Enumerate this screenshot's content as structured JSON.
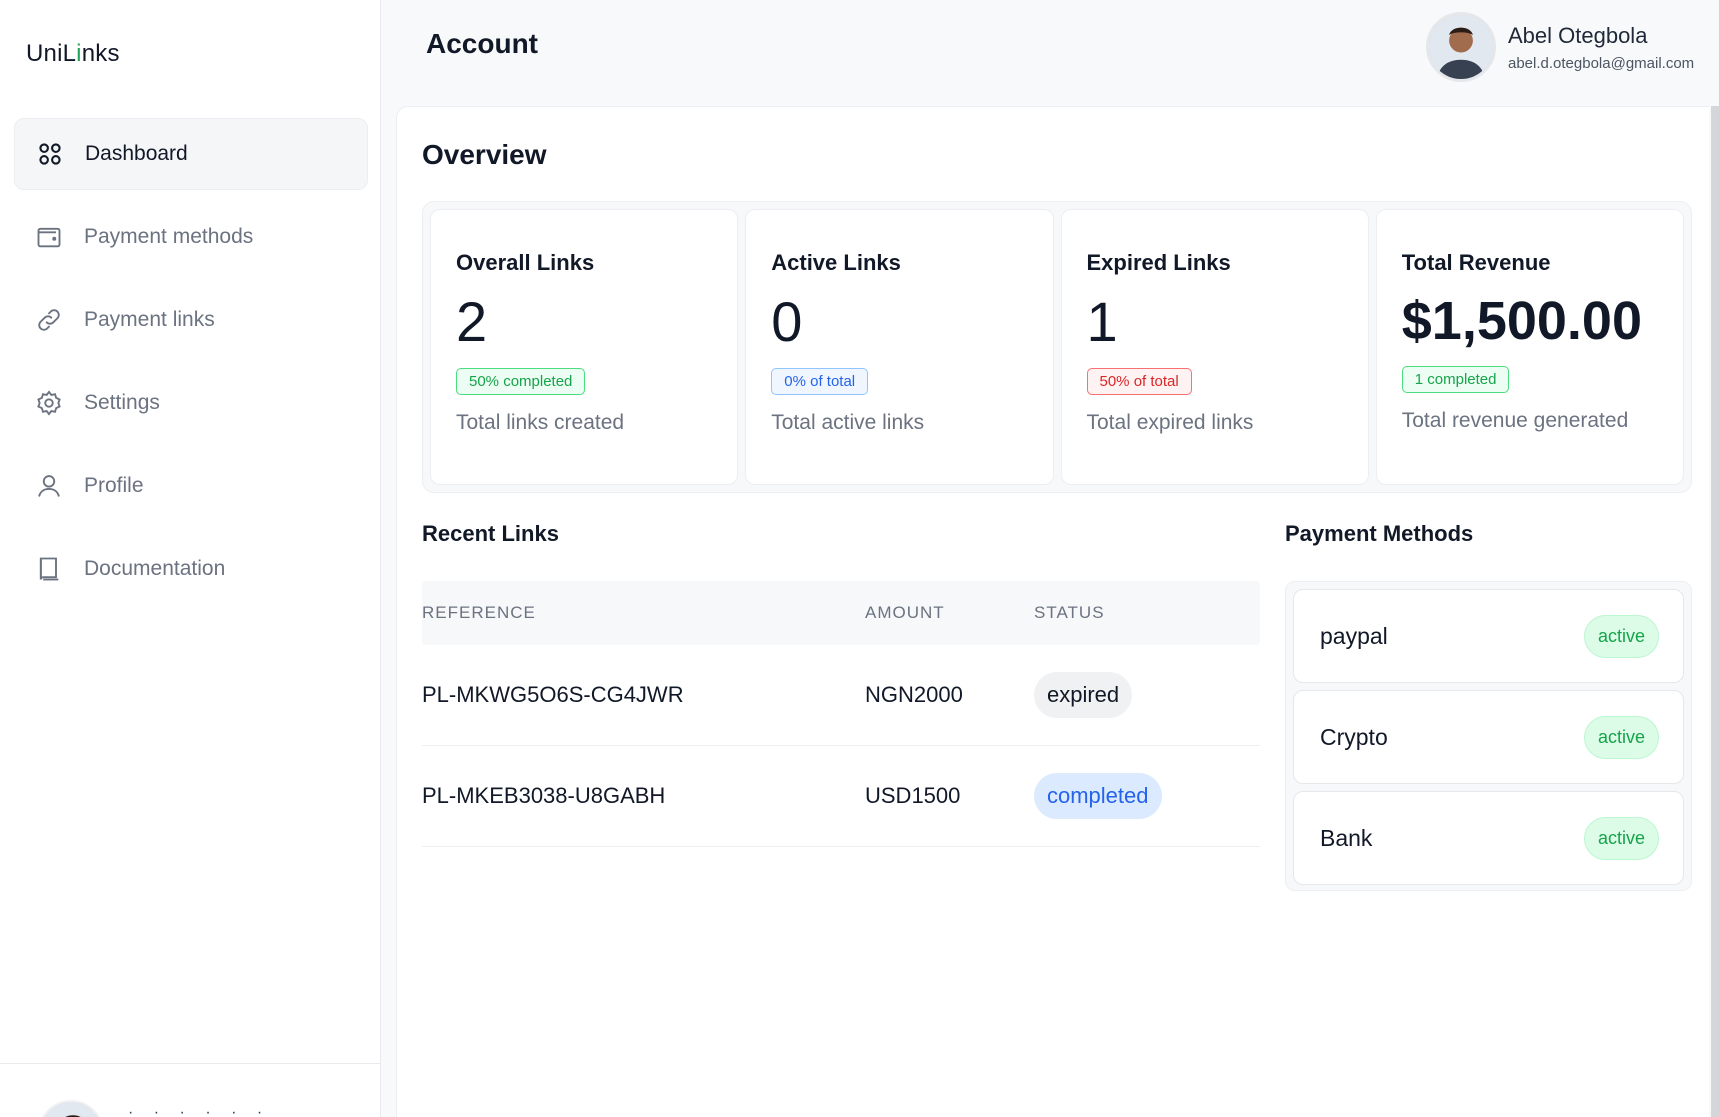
{
  "brand": {
    "name_before": "UniL",
    "name_dot": "i",
    "name_after": "nks"
  },
  "header": {
    "title": "Account"
  },
  "user": {
    "name": "Abel Otegbola",
    "email": "abel.d.otegbola@gmail.com"
  },
  "sidebar": {
    "items": [
      {
        "label": "Dashboard",
        "icon": "grid-icon",
        "active": true
      },
      {
        "label": "Payment methods",
        "icon": "wallet-icon"
      },
      {
        "label": "Payment links",
        "icon": "link-icon"
      },
      {
        "label": "Settings",
        "icon": "gear-icon"
      },
      {
        "label": "Profile",
        "icon": "user-icon"
      },
      {
        "label": "Documentation",
        "icon": "book-icon"
      }
    ],
    "footer_dots": "· · · · · ·"
  },
  "overview": {
    "title": "Overview",
    "stats": [
      {
        "title": "Overall Links",
        "value": "2",
        "pill": "50% completed",
        "pill_color": "#16a34a",
        "subtitle": "Total links created"
      },
      {
        "title": "Active Links",
        "value": "0",
        "pill": "0% of total",
        "pill_color": "#2563eb",
        "subtitle": "Total active links"
      },
      {
        "title": "Expired Links",
        "value": "1",
        "pill": "50% of total",
        "pill_color": "#dc2626",
        "subtitle": "Total expired links"
      },
      {
        "title": "Total Revenue",
        "value": "$1,500.00",
        "pill": "1 completed",
        "pill_color": "#16a34a",
        "subtitle": "Total revenue generated"
      }
    ]
  },
  "recent_links": {
    "title": "Recent Links",
    "columns": [
      "REFERENCE",
      "AMOUNT",
      "STATUS"
    ],
    "rows": [
      {
        "reference": "PL-MKWG5O6S-CG4JWR",
        "amount": "NGN2000",
        "status": "expired"
      },
      {
        "reference": "PL-MKEB3038-U8GABH",
        "amount": "USD1500",
        "status": "completed"
      }
    ]
  },
  "payment_methods": {
    "title": "Payment Methods",
    "items": [
      {
        "name": "paypal",
        "status": "active"
      },
      {
        "name": "Crypto",
        "status": "active"
      },
      {
        "name": "Bank",
        "status": "active"
      }
    ]
  },
  "colors": {
    "accent_green": "#22a55a",
    "badge_blue": "#2563eb",
    "badge_red": "#dc2626"
  }
}
